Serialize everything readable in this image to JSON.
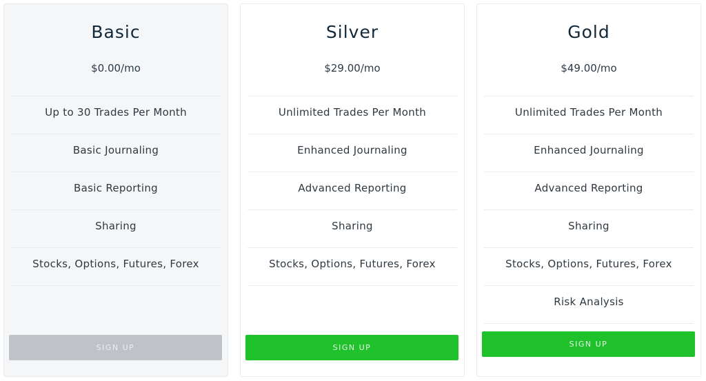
{
  "plans": [
    {
      "name": "Basic",
      "price": "$0.00/mo",
      "features": [
        "Up to 30 Trades Per Month",
        "Basic Journaling",
        "Basic Reporting",
        "Sharing",
        "Stocks, Options, Futures, Forex"
      ],
      "button_label": "SIGN UP",
      "button_state": "disabled",
      "button_color": "#bfc2c6"
    },
    {
      "name": "Silver",
      "price": "$29.00/mo",
      "features": [
        "Unlimited Trades Per Month",
        "Enhanced Journaling",
        "Advanced Reporting",
        "Sharing",
        "Stocks, Options, Futures, Forex"
      ],
      "button_label": "SIGN UP",
      "button_state": "enabled",
      "button_color": "#20c22c"
    },
    {
      "name": "Gold",
      "price": "$49.00/mo",
      "features": [
        "Unlimited Trades Per Month",
        "Enhanced Journaling",
        "Advanced Reporting",
        "Sharing",
        "Stocks, Options, Futures, Forex",
        "Risk Analysis"
      ],
      "button_label": "SIGN UP",
      "button_state": "enabled",
      "button_color": "#20c22c"
    }
  ]
}
